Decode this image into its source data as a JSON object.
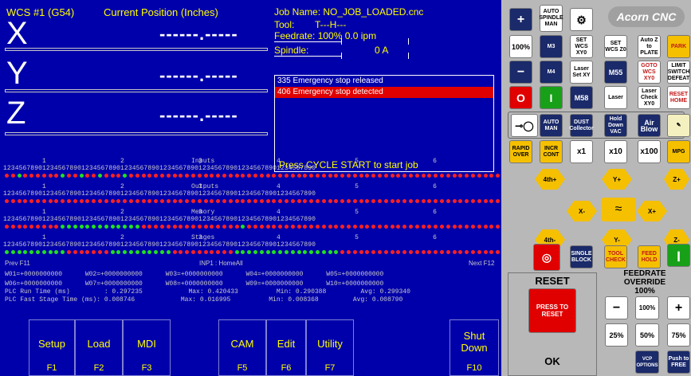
{
  "dro": {
    "wcs_label": "WCS #1 (G54)",
    "position_label": "Current Position (Inches)",
    "axes": [
      {
        "letter": "X",
        "value": "------.-----"
      },
      {
        "letter": "Y",
        "value": "------.-----"
      },
      {
        "letter": "Z",
        "value": "------.-----"
      }
    ]
  },
  "job": {
    "name_label": "Job Name: NO_JOB_LOADED.cnc",
    "tool_label": "Tool:",
    "tool_value": "T---H---",
    "feedrate_label": "Feedrate: 100%  0.0 ipm",
    "spindle_label": "Spindle:",
    "spindle_value": "0 A"
  },
  "messages": [
    {
      "text": "335 Emergency stop released",
      "error": false
    },
    {
      "text": "406 Emergency stop detected",
      "error": true
    }
  ],
  "cycle_message": "Press CYCLE START to start job",
  "io": {
    "rulers": [
      {
        "title": "Inputs",
        "digits": "1 2 3 4 5 6 7 8 9 0 1 2 3 4 5 6 7 8 9 0 1 2 3 4 5 6 7 8 9 0 1 2 3 4 5 6 7 8 9 0 1 2 3 4 5 6 7 8 9 0 1 2 3 4 5 6 7 8 9 0 1 2 3 4 5 6 7 8 9 0 1 2 3 4 5 6 7 8 9 0",
        "groups": "          1                   2                   3                   4                   5                   6                   7                   8"
      },
      {
        "title": "Outputs",
        "digits": "1 2 3 4 5 6 7 8 9 0 1 2 3 4 5 6 7 8 9 0 1 2 3 4 5 6 7 8 9 0 1 2 3 4 5 6 7 8 9 0 1 2 3 4 5 6 7 8 9 0 1 2 3 4 5 6 7 8 9 0 1 2 3 4 5 6 7 8 9 0 1 2 3 4 5 6 7 8 9 0",
        "groups": "          1                   2                   3                   4                   5                   6                   7                   8"
      },
      {
        "title": "Memory",
        "digits": "1 2 3 4 5 6 7 8 9 0 1 2 3 4 5 6 7 8 9 0 1 2 3 4 5 6 7 8 9 0 1 2 3 4 5 6 7 8 9 0 1 2 3 4 5 6 7 8 9 0 1 2 3 4 5 6 7 8 9 0 1 2 3 4 5 6 7 8 9 0 1 2 3 4 5 6 7 8 9 0",
        "groups": "          1                   2                   3                   4                   5                   6                   7                   8"
      },
      {
        "title": "Stages",
        "digits": "1 2 3 4 5 6 7 8 9 0 1 2 3 4 5 6 7 8 9 0 1 2 3 4 5 6 7 8 9 0 1 2 3 4 5 6 7 8 9 0 1 2 3 4 5 6 7 8 9 0 1 2 3 4 5 6 7 8 9 0 1 2 3 4 5 6 7 8 9 0 1 2 3 4 5 6 7 8 9 0",
        "groups": "          1                   2                   3                   4                   5                   6                   7                   8"
      }
    ],
    "colors": {
      "off": "#ff2020",
      "on": "#20e020"
    },
    "inputs_green": [
      2,
      9,
      12,
      15,
      19
    ],
    "outputs_green": [],
    "memory_green": [
      9,
      10,
      11,
      12,
      13,
      14,
      15,
      16,
      17,
      18,
      19,
      20,
      21,
      38
    ],
    "stages_green": [
      0,
      1,
      2,
      3,
      4,
      5,
      6,
      7,
      8,
      9,
      17,
      18,
      19,
      20,
      21,
      22,
      23,
      24,
      25,
      26,
      37,
      38,
      39,
      40,
      41,
      42,
      43,
      44,
      45,
      46,
      47,
      48,
      49,
      50,
      51,
      52,
      53
    ]
  },
  "status": {
    "prev": "Prev F11",
    "inp": "INP1 : HomeAll",
    "next": "Next F12",
    "wcs_row1": "W01=+0000000000      W02=+0000000000      W03=+0000000000      W04=+0000000000      W05=+0000000000",
    "wcs_row2": "W06=+0000000000      W07=+0000000000      W08=+0000000000      W09=+0000000000      W10=+0000000000",
    "plc_run": "PLC Run Time (ms)         : 0.297235            Max: 0.420433          Min: 0.290388         Avg: 0.299340",
    "plc_fast": "PLC Fast Stage Time (ms): 0.008746            Max: 0.016995          Min: 0.008368         Avg: 0.008790"
  },
  "fkeys": [
    {
      "label": "Setup",
      "key": "F1"
    },
    {
      "label": "Load",
      "key": "F2"
    },
    {
      "label": "MDI",
      "key": "F3"
    },
    {
      "label": "CAM",
      "key": "F5"
    },
    {
      "label": "Edit",
      "key": "F6"
    },
    {
      "label": "Utility",
      "key": "F7"
    },
    {
      "label": "Shut Down",
      "key": "F10"
    }
  ],
  "vcp": {
    "logo": "Acorn CNC",
    "b_plus": "+",
    "b_auto_spindle": "AUTO SPINDLE MAN",
    "b_100": "100%",
    "b_m3": "M3",
    "b_set_xy0": "SET WCS XY0",
    "b_set_z0": "SET WCS Z0",
    "b_auto_z": "Auto Z to PLATE",
    "b_park": "PARK",
    "b_minus": "−",
    "b_m4": "M4",
    "b_laser_setxy": "Laser Set XY",
    "b_m55": "M55",
    "b_goto": "GOTO WCS XY0",
    "b_limit": "LIMIT SWITCH DEFEAT",
    "b_stop": "O",
    "b_start": "I",
    "b_m58": "M58",
    "b_laser": "Laser",
    "b_laser_check": "Laser Check XY0",
    "b_reset_home": "RESET HOME",
    "b_auto_man": "AUTO MAN",
    "b_dust": "DUST Collector",
    "b_hold_vac": "Hold Down VAC",
    "b_air": "Air Blow",
    "b_rapid": "RAPID OVER",
    "b_incr": "INCR CONT",
    "b_x1": "x1",
    "b_x10": "x10",
    "b_x100": "x100",
    "b_mpg": "MPG",
    "b_4th_plus": "4th+",
    "b_y_plus": "Y+",
    "b_z_plus": "Z+",
    "b_x_minus": "X-",
    "b_x_plus": "X+",
    "b_4th_minus": "4th-",
    "b_y_minus": "Y-",
    "b_z_minus": "Z-",
    "b_single": "SINGLE BLOCK",
    "b_tool_check": "TOOL CHECK",
    "b_feed_hold": "FEED HOLD",
    "feed_override_title": "FEEDRATE OVERRIDE",
    "feed_override_value": "100%",
    "reset_title": "RESET",
    "reset_button": "PRESS TO RESET",
    "reset_state": "OK",
    "fo_minus": "−",
    "fo_100": "100%",
    "fo_plus": "+",
    "fo_25": "25%",
    "fo_50": "50%",
    "fo_75": "75%",
    "vcp_options": "VCP OPTIONS",
    "push_free": "Push to FREE"
  }
}
